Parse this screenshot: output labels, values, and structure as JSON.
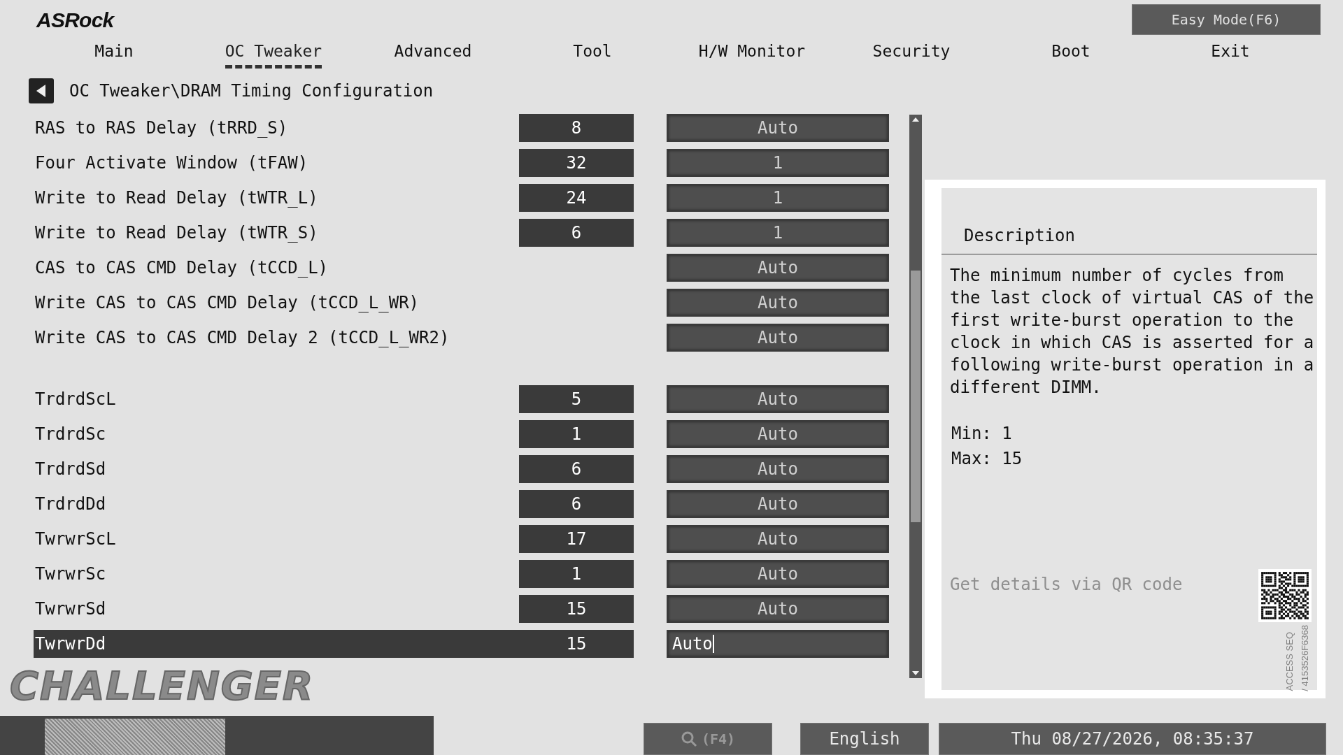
{
  "header": {
    "logo": "ASRock",
    "easy_mode_button": "Easy Mode(F6)"
  },
  "tabs": [
    {
      "label": "Main",
      "selected": false
    },
    {
      "label": "OC Tweaker",
      "selected": true
    },
    {
      "label": "Advanced",
      "selected": false
    },
    {
      "label": "Tool",
      "selected": false
    },
    {
      "label": "H/W Monitor",
      "selected": false
    },
    {
      "label": "Security",
      "selected": false
    },
    {
      "label": "Boot",
      "selected": false
    },
    {
      "label": "Exit",
      "selected": false
    }
  ],
  "breadcrumb": "OC Tweaker\\DRAM Timing Configuration",
  "setting_groups": [
    [
      {
        "label": "RAS to RAS Delay (tRRD_S)",
        "value": "8",
        "setting": "Auto",
        "selected": false
      },
      {
        "label": "Four Activate Window (tFAW)",
        "value": "32",
        "setting": "1",
        "selected": false
      },
      {
        "label": "Write to Read Delay (tWTR_L)",
        "value": "24",
        "setting": "1",
        "selected": false
      },
      {
        "label": "Write to Read Delay (tWTR_S)",
        "value": "6",
        "setting": "1",
        "selected": false
      },
      {
        "label": "CAS to CAS CMD Delay (tCCD_L)",
        "setting": "Auto",
        "selected": false
      },
      {
        "label": "Write CAS to CAS CMD Delay (tCCD_L_WR)",
        "setting": "Auto",
        "selected": false
      },
      {
        "label": "Write CAS to CAS CMD Delay 2 (tCCD_L_WR2)",
        "setting": "Auto",
        "selected": false
      }
    ],
    [
      {
        "label": "TrdrdScL",
        "value": "5",
        "setting": "Auto",
        "selected": false
      },
      {
        "label": "TrdrdSc",
        "value": "1",
        "setting": "Auto",
        "selected": false
      },
      {
        "label": "TrdrdSd",
        "value": "6",
        "setting": "Auto",
        "selected": false
      },
      {
        "label": "TrdrdDd",
        "value": "6",
        "setting": "Auto",
        "selected": false
      },
      {
        "label": "TwrwrScL",
        "value": "17",
        "setting": "Auto",
        "selected": false
      },
      {
        "label": "TwrwrSc",
        "value": "1",
        "setting": "Auto",
        "selected": false
      },
      {
        "label": "TwrwrSd",
        "value": "15",
        "setting": "Auto",
        "selected": false
      },
      {
        "label": "TwrwrDd",
        "value": "15",
        "setting": "Auto",
        "selected": true
      }
    ]
  ],
  "description": {
    "title": "Description",
    "text": "The minimum number of cycles from the last clock of virtual CAS of the first write-burst operation to the clock in which CAS is asserted for a following write-burst operation in a different DIMM.",
    "min": "Min: 1",
    "max": "Max: 15",
    "qr_hint": "Get details via QR code",
    "access_seq": "ACCESS SEQ",
    "access_code": "/ 4153526F6368"
  },
  "brand_mark": "CHALLENGER",
  "footer": {
    "search_key": "(F4)",
    "language": "English",
    "datetime": "Thu 08/27/2026, 08:35:37"
  }
}
